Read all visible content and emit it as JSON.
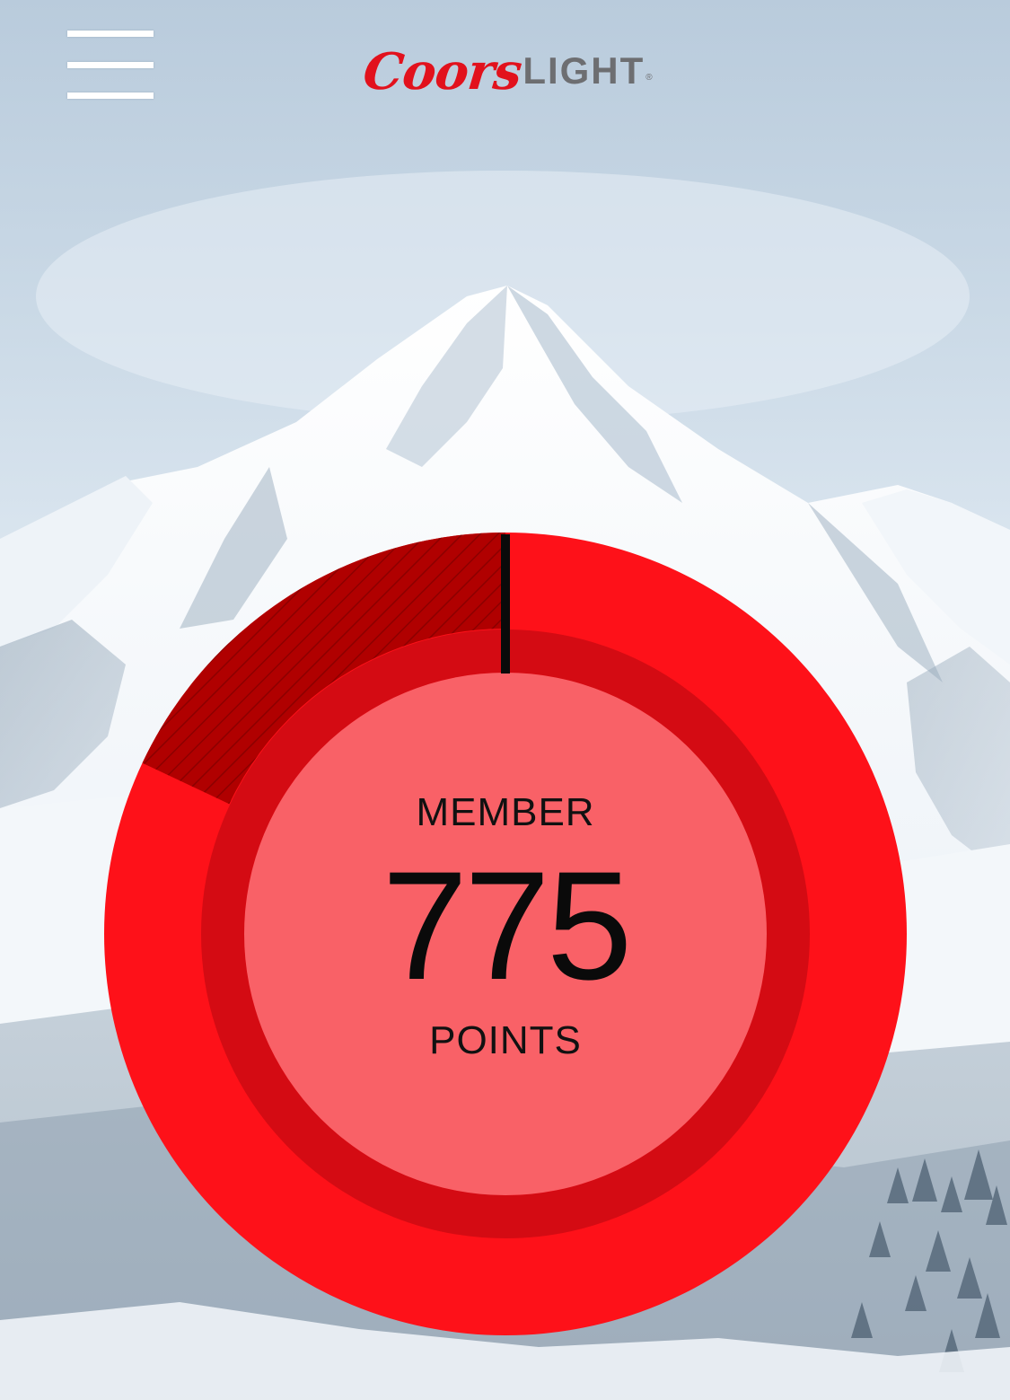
{
  "header": {
    "brand": {
      "word1": "Coors",
      "word2": "LIGHT",
      "reg": "®"
    },
    "menu_icon": "hamburger-menu-icon"
  },
  "rewards": {
    "tier": "MEMBER",
    "points": "775",
    "points_label": "POINTS",
    "progress_fraction": 0.18
  },
  "colors": {
    "ring_bright": "#fe1119",
    "ring_dark": "#b00000",
    "ring_inner": "#d40b13",
    "brand_red": "#e2111c",
    "brand_gray": "#6d6e71"
  }
}
